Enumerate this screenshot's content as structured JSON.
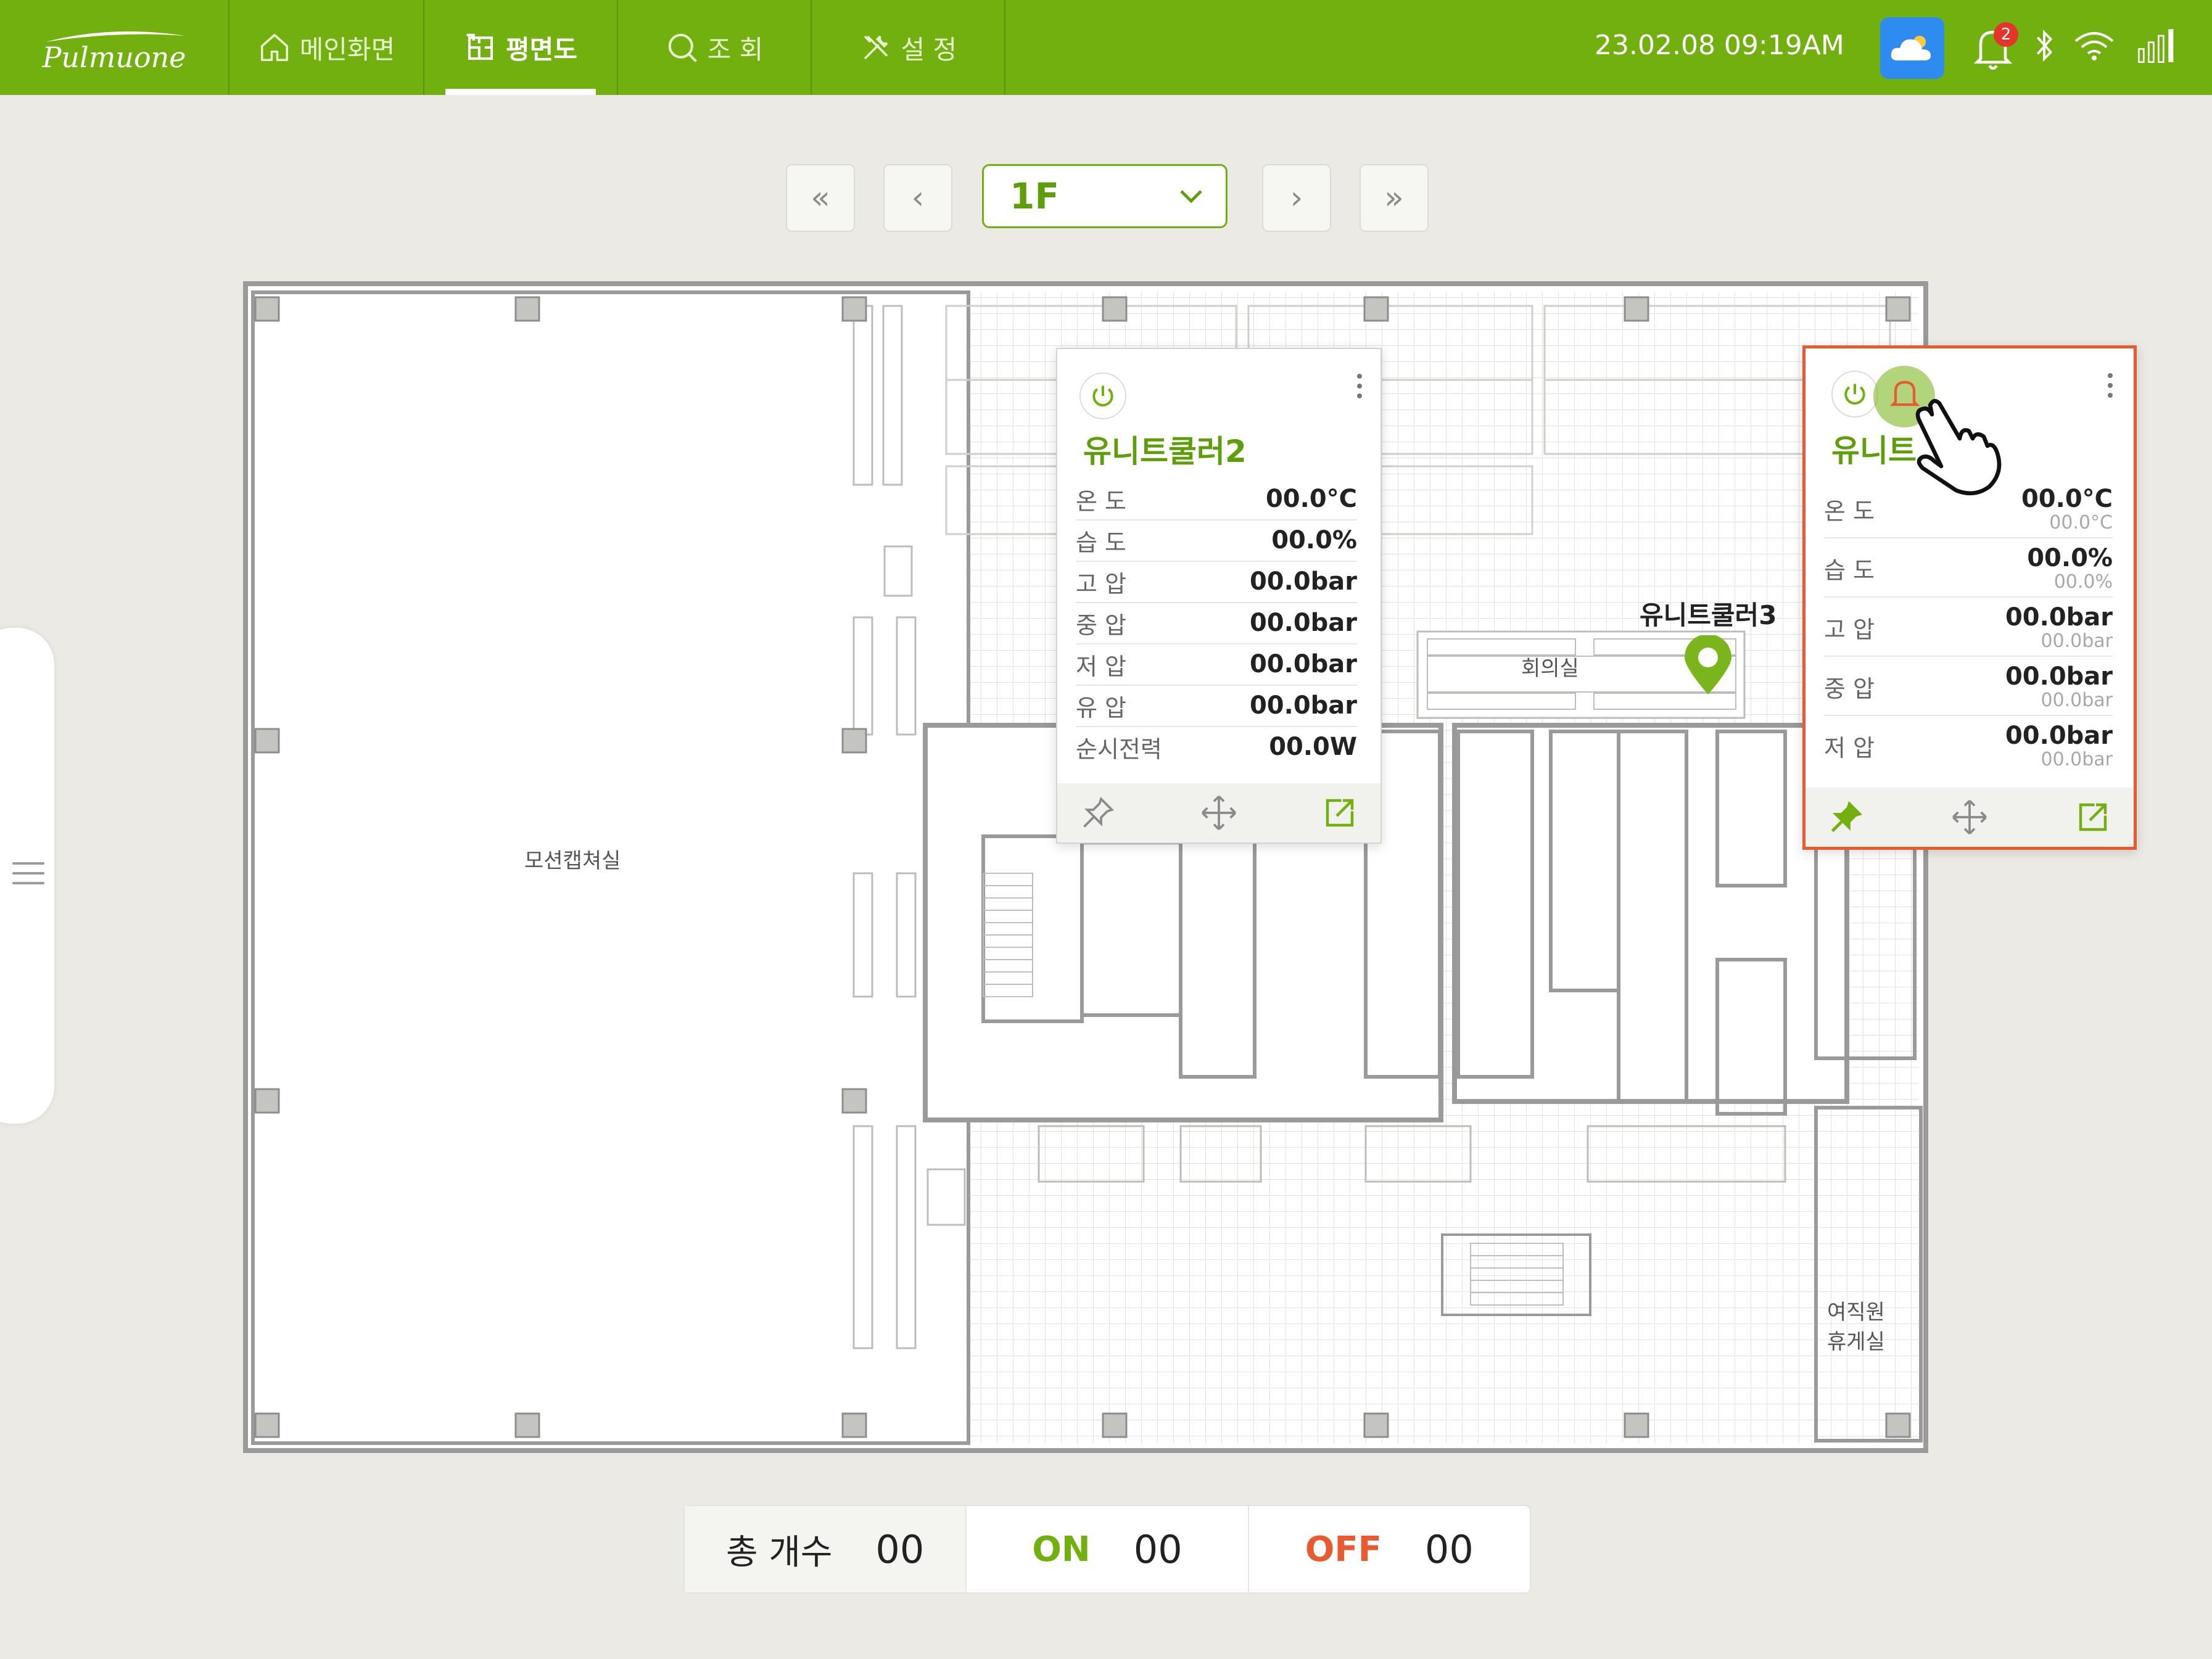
{
  "app": {
    "logo": "Pulmuone"
  },
  "nav": {
    "tabs": [
      {
        "label": "메인화면",
        "icon": "home-icon"
      },
      {
        "label": "평면도",
        "icon": "floorplan-icon",
        "active": true
      },
      {
        "label": "조 회",
        "icon": "search-icon"
      },
      {
        "label": "설 정",
        "icon": "tools-icon"
      }
    ]
  },
  "status": {
    "datetime": "23.02.08  09:19AM",
    "weather_icon": "cloud-icon",
    "notification_count": "2"
  },
  "floor": {
    "selected": "1F",
    "first_label": "«",
    "prev_label": "‹",
    "next_label": "›",
    "last_label": "»"
  },
  "map": {
    "rooms": {
      "motion_capture": "모션캡쳐실",
      "meeting_room": "회의실",
      "lounge": "여직원\n휴게실"
    },
    "pin_label": "유니트쿨러3"
  },
  "card_left": {
    "title": "유니트쿨러2",
    "rows": [
      {
        "label": "온 도",
        "value": "00.0°C"
      },
      {
        "label": "습 도",
        "value": "00.0%"
      },
      {
        "label": "고 압",
        "value": "00.0bar"
      },
      {
        "label": "중 압",
        "value": "00.0bar"
      },
      {
        "label": "저 압",
        "value": "00.0bar"
      },
      {
        "label": "유 압",
        "value": "00.0bar"
      },
      {
        "label": "순시전력",
        "value": "00.0W"
      }
    ]
  },
  "card_right": {
    "title": "유니트",
    "rows": [
      {
        "label": "온 도",
        "value": "00.0°C",
        "sub": "00.0°C"
      },
      {
        "label": "습 도",
        "value": "00.0%",
        "sub": "00.0%"
      },
      {
        "label": "고 압",
        "value": "00.0bar",
        "sub": "00.0bar"
      },
      {
        "label": "중 압",
        "value": "00.0bar",
        "sub": "00.0bar"
      },
      {
        "label": "저 압",
        "value": "00.0bar",
        "sub": "00.0bar"
      }
    ]
  },
  "summary": {
    "total_label": "총 개수",
    "total_value": "00",
    "on_label": "ON",
    "on_value": "00",
    "off_label": "OFF",
    "off_value": "00"
  },
  "colors": {
    "brand": "#72B00F",
    "accent_text": "#5E9E0A",
    "on": "#72B00F",
    "off": "#E85A30",
    "alert_border": "#E85A30",
    "badge": "#E5352A",
    "weather": "#2E8BF0"
  }
}
